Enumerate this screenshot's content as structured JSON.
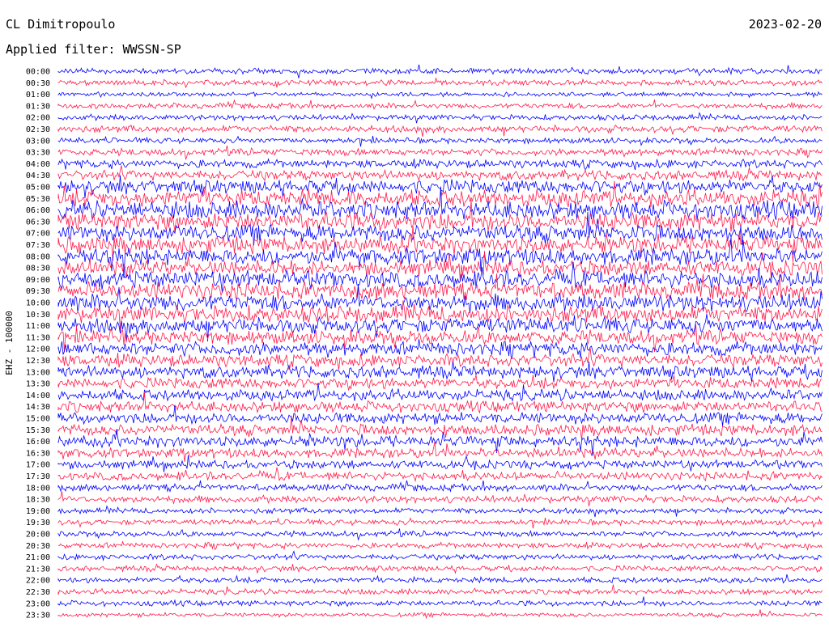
{
  "header": {
    "station": "CL Dimitropoulo",
    "filter": "Applied filter: WWSSN-SP",
    "date": "2023-02-20"
  },
  "chart_data": {
    "type": "line",
    "title": "CL Dimitropoulo",
    "subtitle": "Applied filter: WWSSN-SP",
    "date": "2023-02-20",
    "ylabel": "EHZ - 100000",
    "row_labels": [
      "00:00",
      "00:30",
      "01:00",
      "01:30",
      "02:00",
      "02:30",
      "03:00",
      "03:30",
      "04:00",
      "04:30",
      "05:00",
      "05:30",
      "06:00",
      "06:30",
      "07:00",
      "07:30",
      "08:00",
      "08:30",
      "09:00",
      "09:30",
      "10:00",
      "10:30",
      "11:00",
      "11:30",
      "12:00",
      "12:30",
      "13:00",
      "13:30",
      "14:00",
      "14:30",
      "15:00",
      "15:30",
      "16:00",
      "16:30",
      "17:00",
      "17:30",
      "18:00",
      "18:30",
      "19:00",
      "19:30",
      "20:00",
      "20:30",
      "21:00",
      "21:30",
      "22:00",
      "22:30",
      "23:00",
      "23:30"
    ],
    "row_amplitude": [
      4,
      4,
      3,
      4,
      4,
      5,
      4,
      5,
      6,
      7,
      10,
      12,
      13,
      13,
      12,
      12,
      12,
      11,
      12,
      12,
      12,
      12,
      11,
      10,
      10,
      9,
      9,
      8,
      8,
      8,
      8,
      8,
      8,
      7,
      6,
      6,
      5,
      5,
      4,
      4,
      4,
      4,
      4,
      4,
      4,
      4,
      4,
      3
    ],
    "series_colors": [
      "#0000ff",
      "#ff1a4b"
    ],
    "legend": "none",
    "grid": false
  }
}
